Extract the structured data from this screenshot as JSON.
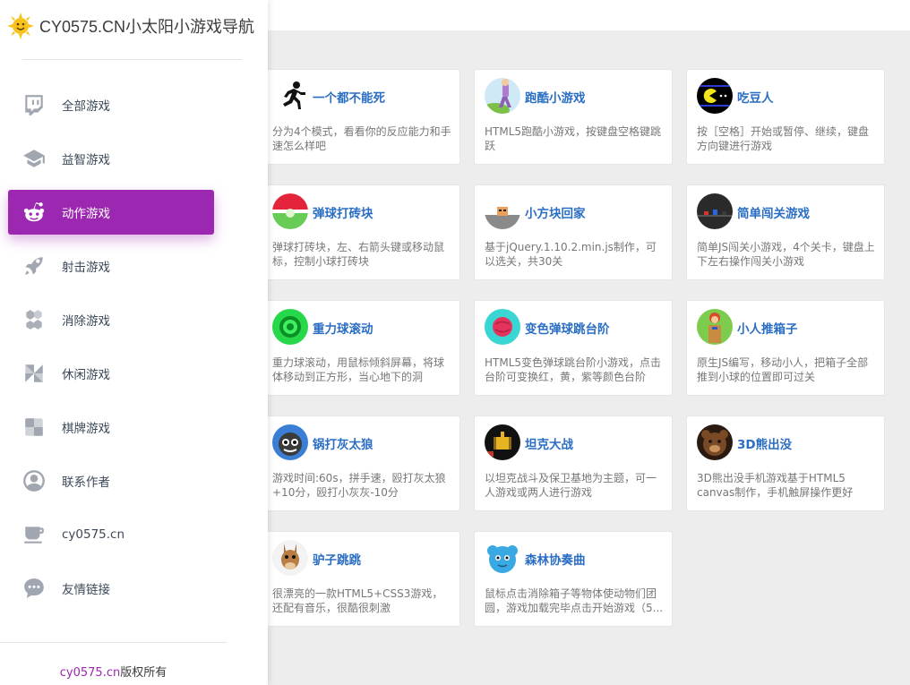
{
  "brand": {
    "title": "CY0575.CN小太阳小游戏导航"
  },
  "sidebar": {
    "items": [
      {
        "label": "全部游戏",
        "icon": "twitch-icon",
        "active": false
      },
      {
        "label": "益智游戏",
        "icon": "graduation-cap-icon",
        "active": false
      },
      {
        "label": "动作游戏",
        "icon": "reddit-icon",
        "active": true
      },
      {
        "label": "射击游戏",
        "icon": "rocket-icon",
        "active": false
      },
      {
        "label": "消除游戏",
        "icon": "blocks-icon",
        "active": false
      },
      {
        "label": "休闲游戏",
        "icon": "pinwheel-icon",
        "active": false
      },
      {
        "label": "棋牌游戏",
        "icon": "checker-icon",
        "active": false
      },
      {
        "label": "联系作者",
        "icon": "user-circle-icon",
        "active": false
      },
      {
        "label": "cy0575.cn",
        "icon": "coffee-cup-icon",
        "active": false
      },
      {
        "label": "友情链接",
        "icon": "chat-bubble-icon",
        "active": false
      }
    ]
  },
  "footer": {
    "link": "cy0575.cn",
    "suffix": "版权所有"
  },
  "accent_color": "#9c27b0",
  "link_color": "#2a6ec4",
  "games": [
    {
      "title": "一个都不能死",
      "desc": "分为4个模式，看看你的反应能力和手速怎么样吧",
      "icon": "runner-icon"
    },
    {
      "title": "跑酷小游戏",
      "desc": "HTML5跑酷小游戏，按键盘空格键跳跃",
      "icon": "parkour-icon"
    },
    {
      "title": "吃豆人",
      "desc": "按［空格］开始或暂停、继续，键盘方向键进行游戏",
      "icon": "pacman-icon"
    },
    {
      "title": "弹球打砖块",
      "desc": "弹球打砖块，左、右箭头键或移动鼠标，控制小球打砖块",
      "icon": "breakout-icon"
    },
    {
      "title": "小方块回家",
      "desc": "基于jQuery.1.10.2.min.js制作，可以选关，共30关",
      "icon": "block-home-icon"
    },
    {
      "title": "简单闯关游戏",
      "desc": "简单JS闯关小游戏，4个关卡，键盘上下左右操作闯关小游戏",
      "icon": "dark-level-icon"
    },
    {
      "title": "重力球滚动",
      "desc": "重力球滚动，用鼠标倾斜屏幕，将球体移动到正方形，当心地下的洞",
      "icon": "gravity-ball-icon"
    },
    {
      "title": "变色弹球跳台阶",
      "desc": "HTML5变色弹球跳台阶小游戏，点击台阶可变换红，黄，紫等颜色台阶",
      "icon": "color-ball-icon"
    },
    {
      "title": "小人推箱子",
      "desc": "原生JS编写，移动小人，把箱子全部推到小球的位置即可过关",
      "icon": "sokoban-icon"
    },
    {
      "title": "锅打灰太狼",
      "desc": "游戏时间:60s，拼手速，殴打灰太狼+10分，殴打小灰灰-10分",
      "icon": "wolf-icon"
    },
    {
      "title": "坦克大战",
      "desc": "以坦克战斗及保卫基地为主题，可一人游戏或两人进行游戏",
      "icon": "tank-icon"
    },
    {
      "title": "3D熊出没",
      "desc": "3D熊出没手机游戏基于HTML5 canvas制作，手机触屏操作更好",
      "icon": "bear-icon"
    },
    {
      "title": "驴子跳跳",
      "desc": "很漂亮的一款HTML5+CSS3游戏，还配有音乐，很酷很刺激",
      "icon": "donkey-icon"
    },
    {
      "title": "森林协奏曲",
      "desc": "鼠标点击消除箱子等物体使动物们团圆，游戏加载完毕点击开始游戏（5...",
      "icon": "forest-icon"
    }
  ]
}
